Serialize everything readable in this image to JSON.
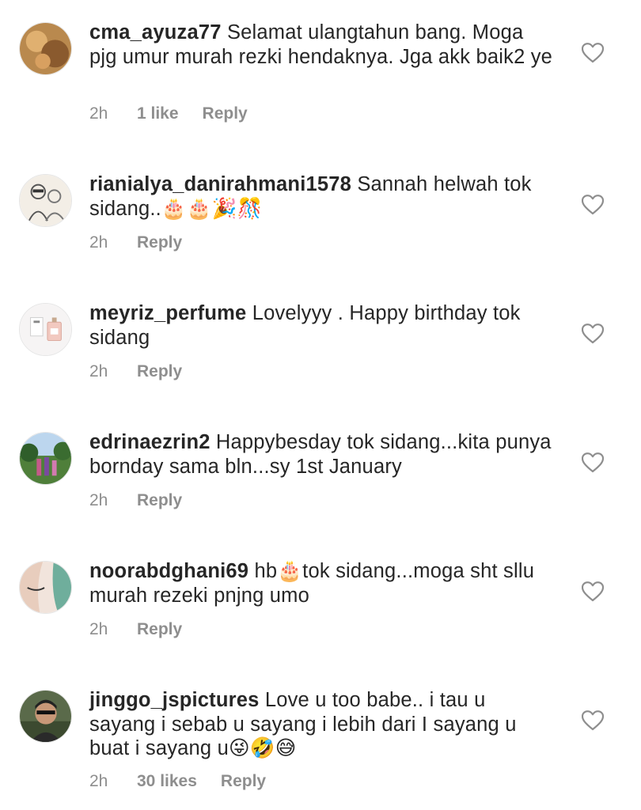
{
  "colors": {
    "text": "#262626",
    "meta": "#8e8e8e",
    "background": "#ffffff",
    "heart_stroke": "#8e8e8e"
  },
  "comments": [
    {
      "username": "cma_ayuza77",
      "text": "Selamat ulangtahun bang. Moga pjg umur murah rezki hendaknya. Jga akk baik2 ye",
      "time": "2h",
      "likes": "1 like",
      "reply": "Reply",
      "icon": "heart-outline-icon"
    },
    {
      "username": "rianialya_danirahmani1578",
      "text": "Sannah helwah tok sidang..🎂🎂🎉🎊",
      "time": "2h",
      "likes": "",
      "reply": "Reply",
      "icon": "heart-outline-icon"
    },
    {
      "username": "meyriz_perfume",
      "text": "Lovelyyy . Happy birthday tok sidang",
      "time": "2h",
      "likes": "",
      "reply": "Reply",
      "icon": "heart-outline-icon"
    },
    {
      "username": "edrinaezrin2",
      "text": "Happybesday tok sidang...kita punya bornday sama bln...sy 1st January",
      "time": "2h",
      "likes": "",
      "reply": "Reply",
      "icon": "heart-outline-icon"
    },
    {
      "username": "noorabdghani69",
      "text": "hb🎂tok sidang...moga sht sllu murah rezeki pnjng umo",
      "time": "2h",
      "likes": "",
      "reply": "Reply",
      "icon": "heart-outline-icon"
    },
    {
      "username": "jinggo_jspictures",
      "text": "Love u too babe.. i tau u sayang i sebab u sayang i lebih dari I sayang u buat i sayang u😜🤣😅",
      "time": "2h",
      "likes": "30 likes",
      "reply": "Reply",
      "icon": "heart-outline-icon"
    }
  ]
}
